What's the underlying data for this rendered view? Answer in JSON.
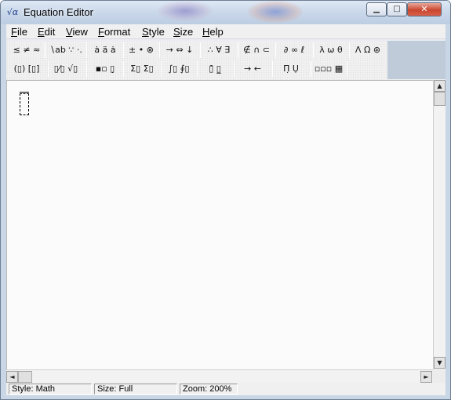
{
  "window": {
    "title": "Equation Editor",
    "app_icon_glyph": "√α",
    "minimize_glyph": "▁",
    "maximize_glyph": "□",
    "close_glyph": "✕"
  },
  "menubar": {
    "items": [
      "File",
      "Edit",
      "View",
      "Format",
      "Style",
      "Size",
      "Help"
    ]
  },
  "toolbar": {
    "row1": [
      {
        "name": "relational-symbols-palette",
        "glyphs": "≤ ≠ ≈"
      },
      {
        "name": "spaces-ellipses-palette",
        "glyphs": "∖ab ∵ ·."
      },
      {
        "name": "embellishments-palette",
        "glyphs": "ȧ ä ȧ"
      },
      {
        "name": "operator-symbols-palette",
        "glyphs": "± • ⊗"
      },
      {
        "name": "arrow-symbols-palette",
        "glyphs": "→ ⇔ ↓"
      },
      {
        "name": "logical-symbols-palette",
        "glyphs": "∴ ∀ ∃"
      },
      {
        "name": "set-theory-symbols-palette",
        "glyphs": "∉ ∩ ⊂"
      },
      {
        "name": "misc-symbols-palette",
        "glyphs": "∂ ∞ ℓ"
      },
      {
        "name": "greek-lowercase-palette",
        "glyphs": "λ ω θ"
      },
      {
        "name": "greek-uppercase-palette",
        "glyphs": "Λ Ω ⊛"
      }
    ],
    "row2": [
      {
        "name": "fence-templates-palette",
        "glyphs": "(▯) [▯]"
      },
      {
        "name": "fraction-radical-templates-palette",
        "glyphs": "▯⁄▯ √▯"
      },
      {
        "name": "subscript-superscript-templates-palette",
        "glyphs": "▪▫ ▯̣"
      },
      {
        "name": "summation-templates-palette",
        "glyphs": "Σ▯ Σ▯"
      },
      {
        "name": "integral-templates-palette",
        "glyphs": "∫▯ ∮▯"
      },
      {
        "name": "underbar-overbar-templates-palette",
        "glyphs": "▯̄ ▯̲"
      },
      {
        "name": "labeled-arrow-templates-palette",
        "glyphs": "→ ←"
      },
      {
        "name": "products-set-theory-templates-palette",
        "glyphs": "Π̣ Ụ"
      },
      {
        "name": "matrix-templates-palette",
        "glyphs": "▫▫▫ ▦"
      }
    ]
  },
  "status": {
    "style": "Style: Math",
    "size": "Size: Full",
    "zoom": "Zoom: 200%"
  },
  "scroll": {
    "up": "▲",
    "down": "▼",
    "left": "◄",
    "right": "►"
  },
  "colors": {
    "frame": "#c9d6e6",
    "toolbar_bg": "#f0f0f0",
    "editor_bg": "#fbfbfb",
    "close_button": "#c9462f"
  }
}
